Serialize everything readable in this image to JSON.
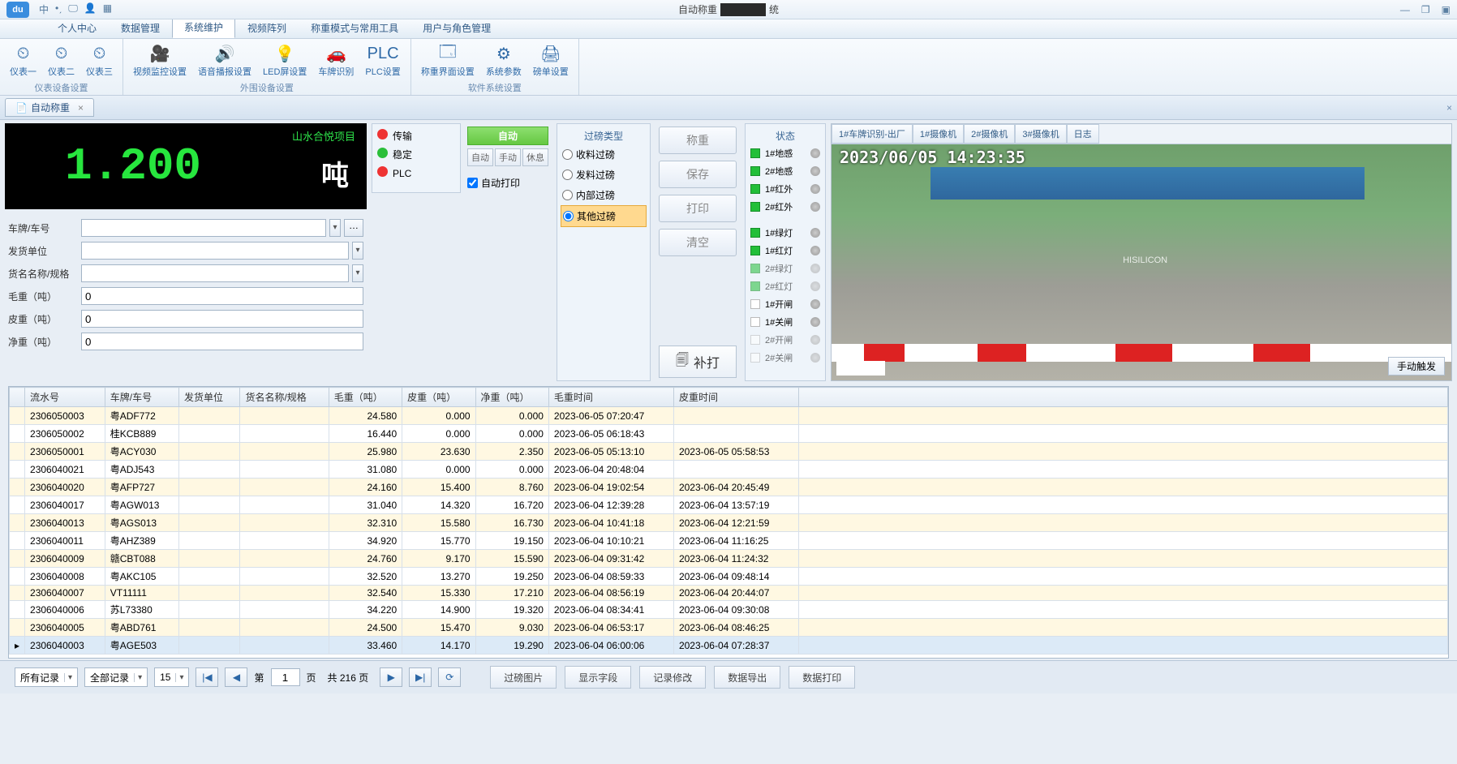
{
  "titlebar": {
    "logo": "du",
    "tool_zh": "中",
    "title_prefix": "自动称重",
    "title_suffix": "统"
  },
  "menu": {
    "items": [
      "个人中心",
      "数据管理",
      "系统维护",
      "视频阵列",
      "称重模式与常用工具",
      "用户与角色管理"
    ],
    "active": 2
  },
  "ribbon": {
    "group1": {
      "btns": [
        "仪表一",
        "仪表二",
        "仪表三"
      ],
      "label": "仪表设备设置"
    },
    "group2": {
      "btns": [
        "视频监控设置",
        "语音播报设置",
        "LED屏设置",
        "车牌识别",
        "PLC设置"
      ],
      "label": "外围设备设置"
    },
    "group3": {
      "btns": [
        "称重界面设置",
        "系统参数",
        "磅单设置"
      ],
      "label": "软件系统设置"
    }
  },
  "doc_tab": "自动称重",
  "weigh": {
    "project": "山水合悦项目",
    "value": "1.200",
    "unit": "吨"
  },
  "status": {
    "s1": "传输",
    "s2": "稳定",
    "s3": "PLC"
  },
  "mode": {
    "auto_btn": "自动",
    "buttons": [
      "自动",
      "手动",
      "休息"
    ],
    "autoprint": "自动打印"
  },
  "form": {
    "plate": "车牌/车号",
    "sender": "发货单位",
    "goods": "货名名称/规格",
    "gross": "毛重（吨）",
    "tare": "皮重（吨）",
    "net": "净重（吨）",
    "gross_v": "0",
    "tare_v": "0",
    "net_v": "0"
  },
  "filter": {
    "title": "过磅类型",
    "opts": [
      "收料过磅",
      "发料过磅",
      "内部过磅",
      "其他过磅"
    ],
    "sel": 3
  },
  "actions": {
    "weigh": "称重",
    "save": "保存",
    "print": "打印",
    "clear": "清空",
    "supplement": "补打"
  },
  "state": {
    "title": "状态",
    "rows1": [
      {
        "l": "1#地感",
        "g": true
      },
      {
        "l": "2#地感",
        "g": true
      },
      {
        "l": "1#红外",
        "g": true
      },
      {
        "l": "2#红外",
        "g": true
      }
    ],
    "rows2": [
      {
        "l": "1#绿灯",
        "g": true
      },
      {
        "l": "1#红灯",
        "g": true
      },
      {
        "l": "2#绿灯",
        "g": true,
        "dim": true
      },
      {
        "l": "2#红灯",
        "g": true,
        "dim": true
      },
      {
        "l": "1#开闸",
        "g": false
      },
      {
        "l": "1#关闸",
        "g": false
      },
      {
        "l": "2#开闸",
        "g": false,
        "dim": true
      },
      {
        "l": "2#关闸",
        "g": false,
        "dim": true
      }
    ]
  },
  "camera": {
    "tabs": [
      "1#车牌识别-出厂",
      "1#摄像机",
      "2#摄像机",
      "3#摄像机",
      "日志"
    ],
    "timestamp": "2023/06/05 14:23:35",
    "brand": "HISILICON",
    "trigger": "手动触发"
  },
  "grid": {
    "cols": [
      "流水号",
      "车牌/车号",
      "发货单位",
      "货名名称/规格",
      "毛重（吨）",
      "皮重（吨）",
      "净重（吨）",
      "毛重时间",
      "皮重时间"
    ],
    "rows": [
      [
        "2306050003",
        "粤ADF772",
        "",
        "",
        "24.580",
        "0.000",
        "0.000",
        "2023-06-05 07:20:47",
        ""
      ],
      [
        "2306050002",
        "桂KCB889",
        "",
        "",
        "16.440",
        "0.000",
        "0.000",
        "2023-06-05 06:18:43",
        ""
      ],
      [
        "2306050001",
        "粤ACY030",
        "",
        "",
        "25.980",
        "23.630",
        "2.350",
        "2023-06-05 05:13:10",
        "2023-06-05 05:58:53"
      ],
      [
        "2306040021",
        "粤ADJ543",
        "",
        "",
        "31.080",
        "0.000",
        "0.000",
        "2023-06-04 20:48:04",
        ""
      ],
      [
        "2306040020",
        "粤AFP727",
        "",
        "",
        "24.160",
        "15.400",
        "8.760",
        "2023-06-04 19:02:54",
        "2023-06-04 20:45:49"
      ],
      [
        "2306040017",
        "粤AGW013",
        "",
        "",
        "31.040",
        "14.320",
        "16.720",
        "2023-06-04 12:39:28",
        "2023-06-04 13:57:19"
      ],
      [
        "2306040013",
        "粤AGS013",
        "",
        "",
        "32.310",
        "15.580",
        "16.730",
        "2023-06-04 10:41:18",
        "2023-06-04 12:21:59"
      ],
      [
        "2306040011",
        "粤AHZ389",
        "",
        "",
        "34.920",
        "15.770",
        "19.150",
        "2023-06-04 10:10:21",
        "2023-06-04 11:16:25"
      ],
      [
        "2306040009",
        "赣CBT088",
        "",
        "",
        "24.760",
        "9.170",
        "15.590",
        "2023-06-04 09:31:42",
        "2023-06-04 11:24:32"
      ],
      [
        "2306040008",
        "粤AKC105",
        "",
        "",
        "32.520",
        "13.270",
        "19.250",
        "2023-06-04 08:59:33",
        "2023-06-04 09:48:14"
      ],
      [
        "2306040007",
        "VT11111",
        "",
        "",
        "32.540",
        "15.330",
        "17.210",
        "2023-06-04 08:56:19",
        "2023-06-04 20:44:07"
      ],
      [
        "2306040006",
        "苏L73380",
        "",
        "",
        "34.220",
        "14.900",
        "19.320",
        "2023-06-04 08:34:41",
        "2023-06-04 09:30:08"
      ],
      [
        "2306040005",
        "粤ABD761",
        "",
        "",
        "24.500",
        "15.470",
        "9.030",
        "2023-06-04 06:53:17",
        "2023-06-04 08:46:25"
      ],
      [
        "2306040003",
        "粤AGE503",
        "",
        "",
        "33.460",
        "14.170",
        "19.290",
        "2023-06-04 06:00:06",
        "2023-06-04 07:28:37"
      ]
    ],
    "selected": 13
  },
  "footer": {
    "combo1": "所有记录",
    "combo2": "全部记录",
    "perpage": "15",
    "page_lbl1": "第",
    "page_val": "1",
    "page_lbl2": "页",
    "total_lbl": "共 216 页",
    "btns": [
      "过磅图片",
      "显示字段",
      "记录修改",
      "数据导出",
      "数据打印"
    ]
  }
}
